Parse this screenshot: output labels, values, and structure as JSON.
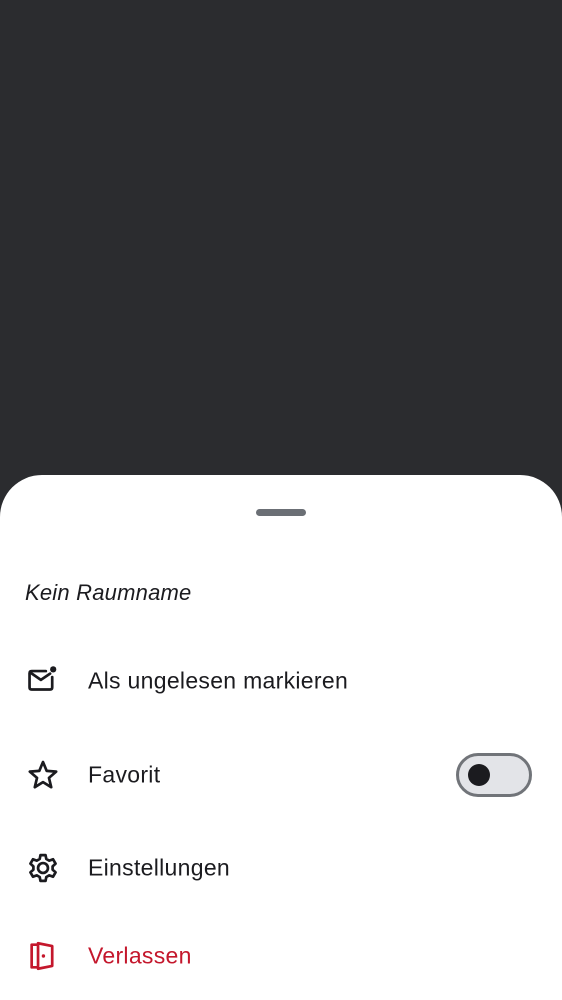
{
  "sheet": {
    "room_title": "Kein Raumname",
    "items": [
      {
        "label": "Als ungelesen markieren",
        "icon": "mark-unread-icon"
      },
      {
        "label": "Favorit",
        "icon": "star-icon",
        "toggle": {
          "on": false
        }
      },
      {
        "label": "Einstellungen",
        "icon": "gear-icon"
      },
      {
        "label": "Verlassen",
        "icon": "leave-door-icon",
        "color": "#c4172c"
      }
    ]
  }
}
